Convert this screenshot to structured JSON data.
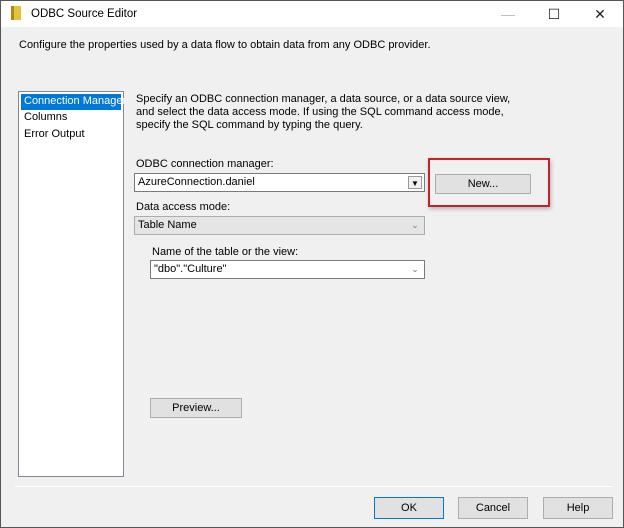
{
  "window": {
    "title": "ODBC Source Editor",
    "minimize_icon": "minimize-icon",
    "maximize_icon": "maximize-icon",
    "close_icon": "close-icon"
  },
  "description": "Configure the properties used by a data flow to obtain data from any ODBC provider.",
  "sidebar": {
    "items": [
      {
        "label": "Connection Manager",
        "selected": true
      },
      {
        "label": "Columns"
      },
      {
        "label": "Error Output"
      }
    ]
  },
  "main": {
    "info": "Specify an ODBC connection manager, a data source, or a data source view, and select the data access mode. If using the SQL command access mode, specify the SQL command by typing the query.",
    "connection_label": "ODBC connection manager:",
    "connection_value": "AzureConnection.daniel",
    "new_button": "New...",
    "access_mode_label": "Data access mode:",
    "access_mode_value": "Table Name",
    "table_label": "Name of the table or the view:",
    "table_value": "\"dbo\".\"Culture\"",
    "preview_button": "Preview..."
  },
  "footer": {
    "ok": "OK",
    "cancel": "Cancel",
    "help": "Help"
  },
  "colors": {
    "selection": "#0078d7",
    "highlight_box": "#c8202a"
  }
}
